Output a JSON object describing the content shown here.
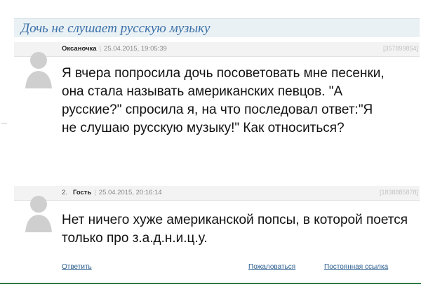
{
  "topic": {
    "title": "Дочь не слушает русскую музыку"
  },
  "posts": [
    {
      "number": "",
      "author": "Оксаночка",
      "datetime": "25.04.2015, 19:05:39",
      "id": "[357899854]",
      "text": "Я вчера попросила дочь посоветовать мне песенки, она стала называть американских певцов. \"А русские?\" спросила я, на что последовал ответ:\"Я не слушаю русскую музыку!\" Как относиться?"
    },
    {
      "number": "2.",
      "author": "Гость",
      "datetime": "25.04.2015, 20:16:14",
      "id": "[1838885878]",
      "text": "Нет ничего хуже американской попсы, в которой поется только про з.а.д.н.и.ц.у."
    }
  ],
  "actions": {
    "reply": "Ответить",
    "complain": "Пожаловаться",
    "permalink": "Постоянная ссылка"
  },
  "colors": {
    "title": "#3a6fa8",
    "link": "#2a5d8f",
    "header_bg": "#e9f1f4",
    "accent_line": "#2f7a4a"
  }
}
